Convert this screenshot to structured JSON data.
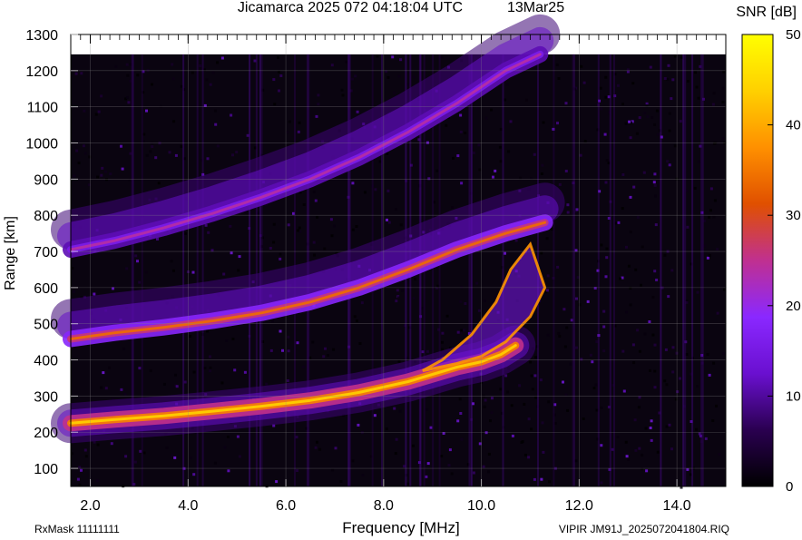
{
  "header": {
    "title_left": "Jicamarca 2025 072 04:18:04 UTC",
    "title_right": "13Mar25"
  },
  "colorbar": {
    "title": "SNR [dB]",
    "min": 0,
    "max": 50,
    "ticks": [
      0,
      10,
      20,
      30,
      40,
      50
    ],
    "colors": [
      "#000000",
      "#2a0050",
      "#6a10d0",
      "#8a28ff",
      "#c03090",
      "#e05000",
      "#ff9000",
      "#ffd000",
      "#ffff00"
    ]
  },
  "footer": {
    "left": "RxMask 11111111",
    "right": "VIPIR  JM91J_2025072041804.RIQ"
  },
  "chart_data": {
    "type": "heatmap",
    "title": "Jicamarca 2025 072 04:18:04 UTC       13Mar25",
    "xlabel": "Frequency [MHz]",
    "ylabel": "Range [km]",
    "xlim": [
      1.6,
      15.0
    ],
    "ylim": [
      50,
      1300
    ],
    "xticks": [
      "2.0",
      "4.0",
      "6.0",
      "8.0",
      "10.0",
      "12.0",
      "14.0"
    ],
    "yticks": [
      "100",
      "200",
      "300",
      "400",
      "500",
      "600",
      "700",
      "800",
      "900",
      "1000",
      "1100",
      "1200",
      "1300"
    ],
    "grid": true,
    "data_top_km": 1245,
    "traces": [
      {
        "x": [
          1.6,
          2.5,
          3.5,
          4.5,
          5.5,
          6.5,
          7.5,
          8.5,
          9.0,
          9.5,
          10.0,
          10.4,
          10.7
        ],
        "y": [
          225,
          235,
          245,
          258,
          272,
          288,
          310,
          340,
          360,
          380,
          395,
          415,
          440
        ],
        "snr": 36
      },
      {
        "x": [
          1.6,
          2.5,
          3.5,
          4.5,
          5.5,
          6.5,
          7.5,
          8.5,
          9.5,
          10.5,
          11.3
        ],
        "y": [
          458,
          475,
          490,
          508,
          530,
          560,
          600,
          650,
          705,
          750,
          780
        ],
        "snr": 26
      },
      {
        "x": [
          1.6,
          2.5,
          3.5,
          4.5,
          5.5,
          6.5,
          7.5,
          8.5,
          9.5,
          10.5,
          11.2
        ],
        "y": [
          705,
          730,
          765,
          805,
          850,
          900,
          960,
          1030,
          1110,
          1200,
          1245
        ],
        "snr": 16
      }
    ],
    "cusp": {
      "x": [
        8.8,
        9.5,
        10.0,
        10.5,
        11.0,
        11.3,
        11.0,
        10.6,
        10.3,
        9.8,
        9.2
      ],
      "y": [
        370,
        390,
        410,
        450,
        520,
        600,
        720,
        650,
        560,
        470,
        400
      ],
      "snr": 38
    }
  }
}
